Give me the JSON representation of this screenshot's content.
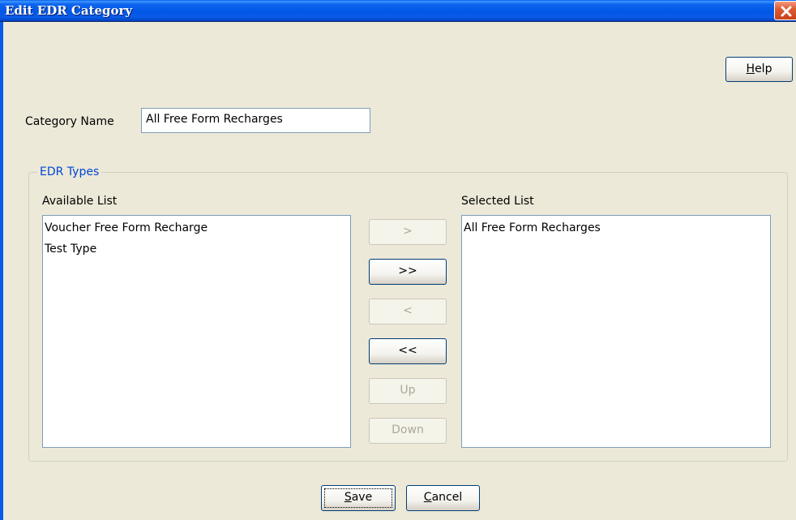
{
  "window": {
    "title": "Edit EDR Category"
  },
  "toolbar": {
    "help_label": "Help",
    "help_mnemonic": "H",
    "help_rest": "elp"
  },
  "category": {
    "label": "Category Name",
    "value": "All Free Form Recharges"
  },
  "edr_types": {
    "group_label": "EDR Types",
    "available_label": "Available List",
    "available_items": [
      "Voucher Free Form Recharge",
      "Test Type"
    ],
    "selected_label": "Selected List",
    "selected_items": [
      "All Free Form Recharges"
    ]
  },
  "transfer_buttons": {
    "add": ">",
    "add_all": ">>",
    "remove": "<",
    "remove_all": "<<",
    "up": "Up",
    "down": "Down"
  },
  "footer": {
    "save_mnemonic": "S",
    "save_rest": "ave",
    "cancel_mnemonic": "C",
    "cancel_rest": "ancel"
  }
}
